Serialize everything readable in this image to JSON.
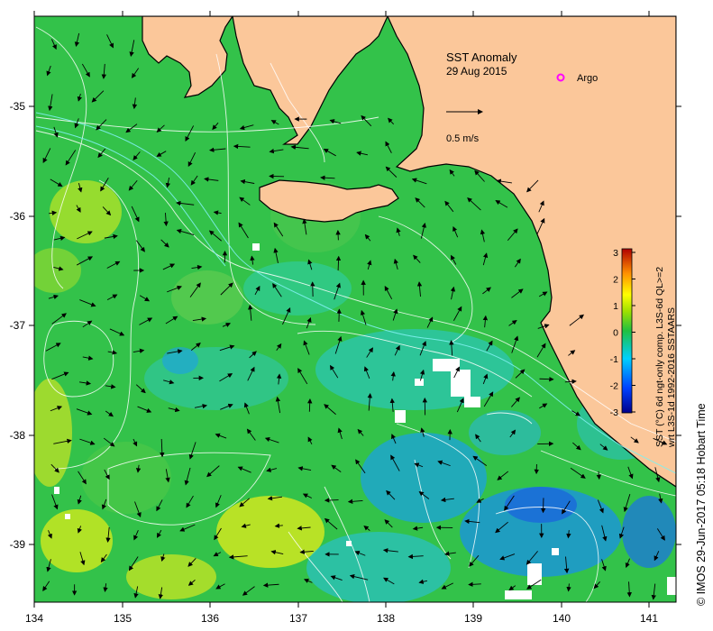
{
  "map": {
    "title": "SST Anomaly",
    "date": "29 Aug 2015",
    "scale_arrow_label": "0.5 m/s",
    "argo_label": "Argo",
    "copyright": "© IMOS 29-Jun-2017 05:18 Hobart Time",
    "x_ticks": [
      "134",
      "135",
      "136",
      "137",
      "138",
      "139",
      "140",
      "141"
    ],
    "y_ticks": [
      "-35",
      "-36",
      "-37",
      "-38",
      "-39"
    ]
  },
  "colorbar": {
    "ticks": [
      "3",
      "2",
      "1",
      "0",
      "-1",
      "-2",
      "-3"
    ],
    "caption_line1": "SST (°C) 6d ngt-only comp. L3S-6d QL>=2",
    "caption_line2": "wrt L3S-1d 1992-2016 SSTAARS"
  },
  "colors": {
    "land": "#fbc79a",
    "ocean_base": "#33c24a",
    "argo": "#ff00ff"
  }
}
